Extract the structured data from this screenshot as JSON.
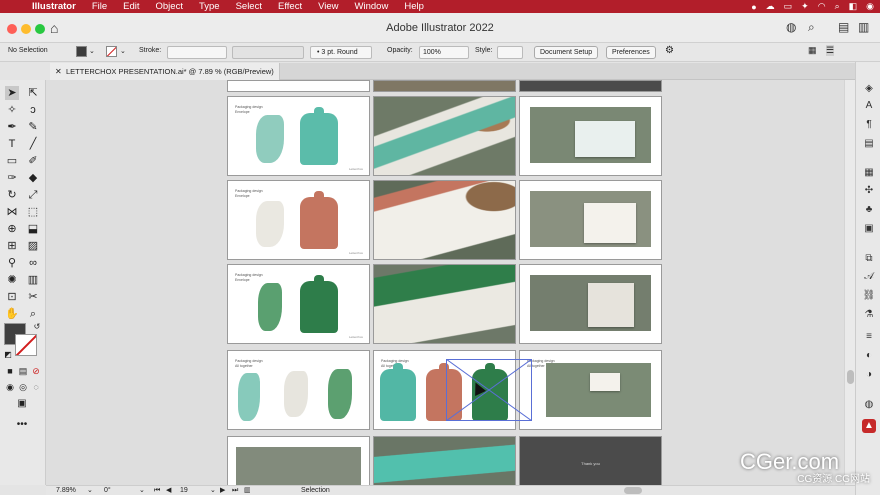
{
  "menubar": {
    "app": "Illustrator",
    "items": [
      "File",
      "Edit",
      "Object",
      "Type",
      "Select",
      "Effect",
      "View",
      "Window",
      "Help"
    ]
  },
  "window": {
    "title": "Adobe Illustrator 2022"
  },
  "control_bar": {
    "selection": "No Selection",
    "stroke_label": "Stroke:",
    "brush": "3 pt. Round",
    "opacity_label": "Opacity:",
    "opacity_value": "100%",
    "style_label": "Style:",
    "document_setup": "Document Setup",
    "preferences": "Preferences"
  },
  "document_tab": {
    "label": "LETTERCHOX PRESENTATION.ai* @ 7.89 % (RGB/Preview)"
  },
  "status_bar": {
    "zoom": "7.89%",
    "rotation": "0°",
    "artboard": "19",
    "mode": "Selection"
  },
  "artboards": {
    "title_label": "Packaging design",
    "subtitle_label": "Envelope",
    "alt_title": "Packaging design",
    "alt_subtitle": "All together",
    "thank_you": "Thank you"
  },
  "colors": {
    "menubar": "#b21e2a",
    "teal": "#52b7a5",
    "terracotta": "#c47560",
    "green": "#2e7d4a",
    "photo_bg": "#6f7f6c",
    "selection": "#5a6fd6"
  },
  "watermark": {
    "big": "CGer.com",
    "small": "CG资源 CG网站"
  }
}
